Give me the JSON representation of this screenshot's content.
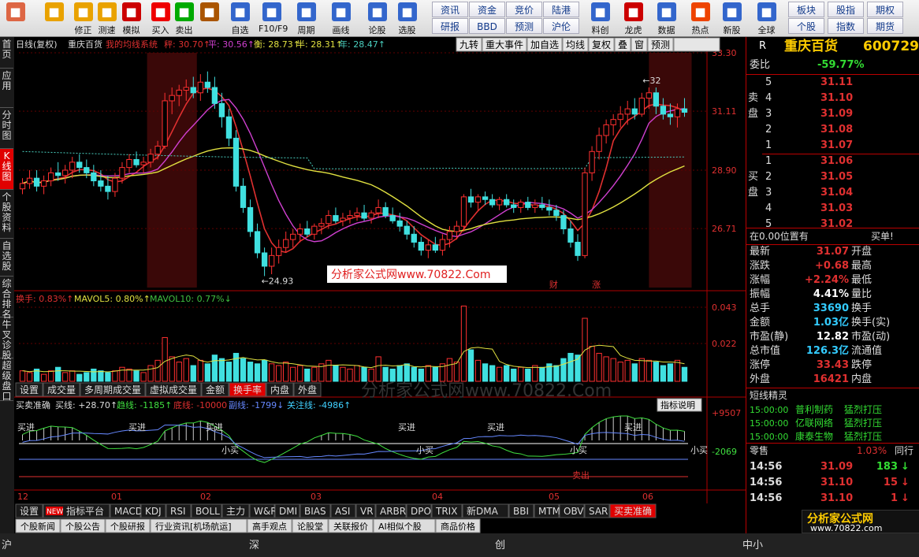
{
  "toolbar": {
    "buttons": [
      {
        "label": "",
        "icon": "home-grid-icon",
        "color": "#d64"
      },
      {
        "label": "",
        "icon": "back-arrow-icon",
        "color": "#e9a200"
      },
      {
        "label": "修正",
        "icon": "arrow-updown-icon",
        "color": "#e9a200"
      },
      {
        "label": "测速",
        "icon": "speed-clock-icon",
        "color": "#e9a200"
      },
      {
        "label": "模拟",
        "icon": "clock-icon",
        "color": "#c00"
      },
      {
        "label": "买入",
        "icon": "buy-icon",
        "color": "#e00"
      },
      {
        "label": "卖出",
        "icon": "sell-icon",
        "color": "#0a0"
      },
      {
        "label": "",
        "icon": "hammer-icon",
        "color": "#a50"
      },
      {
        "label": "自选",
        "icon": "folder-icon",
        "color": "#36c"
      },
      {
        "label": "F10/F9",
        "icon": "f10-icon",
        "color": "#36c"
      },
      {
        "label": "周期",
        "icon": "cycle-clock-icon",
        "color": "#36c"
      },
      {
        "label": "画线",
        "icon": "pencil-icon",
        "color": "#36c"
      },
      {
        "label": "论股",
        "icon": "discuss-icon",
        "color": "#36c"
      },
      {
        "label": "选股",
        "icon": "chart-search-icon",
        "color": "#36c"
      }
    ],
    "small": [
      "资讯",
      "资金",
      "竞价",
      "陆港",
      "研报",
      "BBD",
      "预测",
      "沪伦"
    ],
    "buttons2": [
      {
        "label": "料创",
        "icon": "trend-icon",
        "color": "#36c"
      },
      {
        "label": "龙虎",
        "icon": "dragon-icon",
        "color": "#c00"
      },
      {
        "label": "数据",
        "icon": "pe-icon",
        "color": "#36c"
      },
      {
        "label": "热点",
        "icon": "hot-icon",
        "color": "#e40"
      },
      {
        "label": "新股",
        "icon": "new-stock-icon",
        "color": "#36c"
      },
      {
        "label": "全球",
        "icon": "globe-icon",
        "color": "#36c"
      }
    ],
    "small2": [
      "板块",
      "股指",
      "期权",
      "个股",
      "指数",
      "期货"
    ]
  },
  "left_tabs": [
    "首页",
    "应用",
    "分时图",
    "K线图",
    "个股资料",
    "自选股",
    "综合排名",
    "牛叉诊股",
    "超级盘口"
  ],
  "header": {
    "prefix": "日线(复权)",
    "name": "重庆百货",
    "system": "我的均线系统",
    "ma1": "秤: 30.70↑",
    "ma2": "平: 30.56↑",
    "ma3": "衡: 28.73↑",
    "ma4": "半: 28.31↑",
    "ma5": "年: 28.47↑"
  },
  "chart_buttons": [
    "九转",
    "重大事件",
    "加自选",
    "均线",
    "复权",
    "叠",
    "窗",
    "预测"
  ],
  "price_axis": [
    "33.30",
    "31.11",
    "28.90",
    "26.71"
  ],
  "vol_axis": [
    "0.043",
    "0.022"
  ],
  "ind_axis": [
    "+9507",
    "-2069"
  ],
  "x_axis": [
    "12",
    "01",
    "02",
    "03",
    "04",
    "05",
    "06"
  ],
  "annotations": {
    "high": "32",
    "low": "24.93",
    "watermark": "分析家公式网www.70822.Com",
    "wm_bg": "分析家公式网www.70822.Com",
    "cai": "财",
    "zhang": "涨"
  },
  "chart_data": {
    "type": "candlestick",
    "candles": [
      [
        28.2,
        28.6,
        28.0,
        28.4
      ],
      [
        28.4,
        28.9,
        28.2,
        28.6
      ],
      [
        28.6,
        28.9,
        28.1,
        28.3
      ],
      [
        28.3,
        28.7,
        28.0,
        28.5
      ],
      [
        28.5,
        29.0,
        28.3,
        28.8
      ],
      [
        28.8,
        29.2,
        28.5,
        28.7
      ],
      [
        28.7,
        29.1,
        28.4,
        28.9
      ],
      [
        28.9,
        29.4,
        28.6,
        29.2
      ],
      [
        29.2,
        29.5,
        28.8,
        29.0
      ],
      [
        29.0,
        29.3,
        28.6,
        28.8
      ],
      [
        28.8,
        29.1,
        28.3,
        28.5
      ],
      [
        28.5,
        28.9,
        28.1,
        28.3
      ],
      [
        28.3,
        28.7,
        27.8,
        28.1
      ],
      [
        28.1,
        28.8,
        27.9,
        28.6
      ],
      [
        28.6,
        29.2,
        28.4,
        29.0
      ],
      [
        29.0,
        29.5,
        28.8,
        29.3
      ],
      [
        29.3,
        29.6,
        29.0,
        29.1
      ],
      [
        29.1,
        29.4,
        28.8,
        29.2
      ],
      [
        29.2,
        29.7,
        29.0,
        29.5
      ],
      [
        29.5,
        30.0,
        29.3,
        29.8
      ],
      [
        29.8,
        31.8,
        29.7,
        31.5
      ],
      [
        31.5,
        32.0,
        31.0,
        31.7
      ],
      [
        31.7,
        32.1,
        31.3,
        31.9
      ],
      [
        31.9,
        32.3,
        31.5,
        32.0
      ],
      [
        32.0,
        32.4,
        31.6,
        31.8
      ],
      [
        31.8,
        32.5,
        31.5,
        32.2
      ],
      [
        32.2,
        32.6,
        31.8,
        32.0
      ],
      [
        32.0,
        32.4,
        31.2,
        31.4
      ],
      [
        31.4,
        31.8,
        30.5,
        30.9
      ],
      [
        30.9,
        31.2,
        29.8,
        30.1
      ],
      [
        30.1,
        30.4,
        28.1,
        28.3
      ],
      [
        28.3,
        28.6,
        27.3,
        27.5
      ],
      [
        27.5,
        27.8,
        26.4,
        26.6
      ],
      [
        26.6,
        26.9,
        25.6,
        25.8
      ],
      [
        25.8,
        26.0,
        24.93,
        25.3
      ],
      [
        25.3,
        26.0,
        25.0,
        25.7
      ],
      [
        25.7,
        26.3,
        25.4,
        26.0
      ],
      [
        26.0,
        26.6,
        25.8,
        26.3
      ],
      [
        26.3,
        26.7,
        26.0,
        26.5
      ],
      [
        26.5,
        26.9,
        26.2,
        26.7
      ],
      [
        26.7,
        27.0,
        26.4,
        26.5
      ],
      [
        26.5,
        26.9,
        26.3,
        26.8
      ],
      [
        26.8,
        27.1,
        26.5,
        26.9
      ],
      [
        26.9,
        27.4,
        26.7,
        27.2
      ],
      [
        27.2,
        27.5,
        26.9,
        27.0
      ],
      [
        27.0,
        27.3,
        26.8,
        27.1
      ],
      [
        27.1,
        27.4,
        26.9,
        27.2
      ],
      [
        27.2,
        27.5,
        27.0,
        27.3
      ],
      [
        27.3,
        27.6,
        27.0,
        27.1
      ],
      [
        27.1,
        27.4,
        26.9,
        27.3
      ],
      [
        27.3,
        27.8,
        27.1,
        27.5
      ],
      [
        27.5,
        27.7,
        27.1,
        27.2
      ],
      [
        27.2,
        27.5,
        26.9,
        27.0
      ],
      [
        27.0,
        27.3,
        26.6,
        26.8
      ],
      [
        26.8,
        27.0,
        26.3,
        26.5
      ],
      [
        26.5,
        26.8,
        26.0,
        26.2
      ],
      [
        26.2,
        26.4,
        25.7,
        25.9
      ],
      [
        25.9,
        26.3,
        25.6,
        26.1
      ],
      [
        26.1,
        26.4,
        25.8,
        25.9
      ],
      [
        25.9,
        26.5,
        25.7,
        26.3
      ],
      [
        26.3,
        26.8,
        26.0,
        26.6
      ],
      [
        26.6,
        27.0,
        26.3,
        26.8
      ],
      [
        26.8,
        28.0,
        26.6,
        27.9
      ],
      [
        27.9,
        28.2,
        27.5,
        27.7
      ],
      [
        27.7,
        28.0,
        27.4,
        27.9
      ],
      [
        27.9,
        28.1,
        27.6,
        27.8
      ],
      [
        27.8,
        28.0,
        27.5,
        27.6
      ],
      [
        27.6,
        27.9,
        27.4,
        27.8
      ],
      [
        27.8,
        28.0,
        27.5,
        27.6
      ],
      [
        27.6,
        27.8,
        27.3,
        27.5
      ],
      [
        27.5,
        27.8,
        27.3,
        27.7
      ],
      [
        27.7,
        27.9,
        27.4,
        27.5
      ],
      [
        27.5,
        27.8,
        27.3,
        27.6
      ],
      [
        27.6,
        27.9,
        27.4,
        27.5
      ],
      [
        27.5,
        27.8,
        27.2,
        27.4
      ],
      [
        27.4,
        27.6,
        27.0,
        27.2
      ],
      [
        27.2,
        27.4,
        26.5,
        26.7
      ],
      [
        26.7,
        27.0,
        26.0,
        26.2
      ],
      [
        26.2,
        26.5,
        25.5,
        25.7
      ],
      [
        25.7,
        29.0,
        25.6,
        28.8
      ],
      [
        28.8,
        29.8,
        28.5,
        29.6
      ],
      [
        29.6,
        30.5,
        29.3,
        30.2
      ],
      [
        30.2,
        30.8,
        29.9,
        30.6
      ],
      [
        30.6,
        31.0,
        30.2,
        30.8
      ],
      [
        30.8,
        31.3,
        30.5,
        31.0
      ],
      [
        31.0,
        31.5,
        30.6,
        31.2
      ],
      [
        31.2,
        31.6,
        30.8,
        31.0
      ],
      [
        31.0,
        31.8,
        30.9,
        31.6
      ],
      [
        31.6,
        32.0,
        31.2,
        31.8
      ],
      [
        31.8,
        32.0,
        31.0,
        31.3
      ],
      [
        31.3,
        31.6,
        30.8,
        31.0
      ],
      [
        31.0,
        31.4,
        30.6,
        30.9
      ],
      [
        30.9,
        31.4,
        30.5,
        31.2
      ],
      [
        31.2,
        31.6,
        30.9,
        31.07
      ]
    ],
    "ma_series": [
      {
        "name": "秤",
        "color": "#e03030"
      },
      {
        "name": "平",
        "color": "#d040d0"
      },
      {
        "name": "半",
        "color": "#e0e040"
      },
      {
        "name": "年",
        "color": "#4ad0c0"
      }
    ],
    "ylim": [
      24.5,
      33.3
    ],
    "volume_pct": [
      0.6,
      0.5,
      0.7,
      0.4,
      0.6,
      0.8,
      0.5,
      0.6,
      0.4,
      0.5,
      0.7,
      0.6,
      0.5,
      0.6,
      0.8,
      0.7,
      0.6,
      0.5,
      0.9,
      1.2,
      2.5,
      1.4,
      1.1,
      1.3,
      0.9,
      1.2,
      1.0,
      1.5,
      1.3,
      1.1,
      1.6,
      1.3,
      1.1,
      1.0,
      1.2,
      1.0,
      0.9,
      1.1,
      0.8,
      0.9,
      0.7,
      0.8,
      1.0,
      1.2,
      0.9,
      0.8,
      0.7,
      0.9,
      0.8,
      0.7,
      1.4,
      0.8,
      0.7,
      0.9,
      1.0,
      0.8,
      0.7,
      0.9,
      0.8,
      1.0,
      1.3,
      1.1,
      4.3,
      1.8,
      1.2,
      1.0,
      0.9,
      0.8,
      0.9,
      0.7,
      0.8,
      0.7,
      0.9,
      0.8,
      1.0,
      0.9,
      1.3,
      1.6,
      1.5,
      3.6,
      2.0,
      1.6,
      1.4,
      1.3,
      1.1,
      1.2,
      1.0,
      1.3,
      1.2,
      1.1,
      0.9,
      1.0,
      1.2,
      0.8
    ]
  },
  "vol_header": {
    "a": "换手: 0.83%↑",
    "b": "MAVOL5: 0.80%↑",
    "c": "MAVOL10: 0.77%↓"
  },
  "vol_tabs": [
    "设置",
    "成交量",
    "多周期成交量",
    "虚拟成交量",
    "金额",
    "换手率",
    "内盘",
    "外盘"
  ],
  "ind_header": {
    "name": "买卖准确",
    "a": "买线: +28.70↑",
    "b": "趋线: -1185↑",
    "c": "底线: -10000",
    "d": "副线: -1799↓",
    "e": "关注线: -4986↑",
    "btn": "指标说明"
  },
  "ind_labels": {
    "buy": "买进",
    "small": "小买",
    "sell": "卖出"
  },
  "ind_tabs": [
    "设置",
    "指标平台",
    "MACD",
    "KDJ",
    "RSI",
    "BOLL",
    "主力",
    "W&R",
    "DMI",
    "BIAS",
    "ASI",
    "VR",
    "ARBR",
    "DPO",
    "TRIX",
    "新DMA",
    "BBI",
    "MTM",
    "OBV",
    "SAR",
    "买卖准确"
  ],
  "new_badge": "NEW",
  "news_tabs": [
    "个股新闻",
    "个股公告",
    "个股研报",
    "行业资讯[机场航运]",
    "高手观点",
    "论股堂",
    "关联报价",
    "AI相似个股",
    "商品价格"
  ],
  "right": {
    "title": "重庆百货",
    "code": "600729",
    "r": "R",
    "wb_label": "委比",
    "wb_val": "-59.77%",
    "sell_label": "卖盘",
    "buy_label": "买盘",
    "sell": [
      {
        "n": "5",
        "p": "31.11"
      },
      {
        "n": "4",
        "p": "31.10"
      },
      {
        "n": "3",
        "p": "31.09"
      },
      {
        "n": "2",
        "p": "31.08"
      },
      {
        "n": "1",
        "p": "31.07"
      }
    ],
    "buy": [
      {
        "n": "1",
        "p": "31.06"
      },
      {
        "n": "2",
        "p": "31.05"
      },
      {
        "n": "3",
        "p": "31.04"
      },
      {
        "n": "4",
        "p": "31.03"
      },
      {
        "n": "5",
        "p": "31.02"
      }
    ],
    "pos": "在0.00位置有",
    "pos_r": "买单!",
    "quote": [
      {
        "k": "最新",
        "v": "31.07",
        "k2": "开盘",
        "c": "#e03030"
      },
      {
        "k": "涨跌",
        "v": "+0.68",
        "k2": "最高",
        "c": "#e03030"
      },
      {
        "k": "涨幅",
        "v": "+2.24%",
        "k2": "最低",
        "c": "#e03030"
      },
      {
        "k": "振幅",
        "v": "4.41%",
        "k2": "量比",
        "c": "#ffffff"
      },
      {
        "k": "总手",
        "v": "33690",
        "k2": "换手",
        "c": "#33ccff"
      },
      {
        "k": "金额",
        "v": "1.03亿",
        "k2": "换手(实)",
        "c": "#33ccff"
      },
      {
        "k": "市盈(静)",
        "v": "12.82",
        "k2": "市盈(动)",
        "c": "#ffffff"
      },
      {
        "k": "总市值",
        "v": "126.3亿",
        "k2": "流通值",
        "c": "#33ccff"
      },
      {
        "k": "涨停",
        "v": "33.43",
        "k2": "跌停",
        "c": "#e03030"
      },
      {
        "k": "外盘",
        "v": "16421",
        "k2": "内盘",
        "c": "#e03030"
      }
    ],
    "jl_title": "短线精灵",
    "jl": [
      {
        "t": "15:00:00",
        "n": "普利制药",
        "s": "猛烈打压"
      },
      {
        "t": "15:00:00",
        "n": "亿联网络",
        "s": "猛烈打压"
      },
      {
        "t": "15:00:00",
        "n": "康泰生物",
        "s": "猛烈打压"
      }
    ],
    "ls_title": "零售",
    "ls_pct": "1.03%",
    "ls_tab": "同行",
    "trades": [
      {
        "t": "14:56",
        "p": "31.09",
        "v": "183",
        "d": "↓",
        "c": "#33dd33"
      },
      {
        "t": "14:56",
        "p": "31.10",
        "v": "15",
        "d": "↓",
        "c": "#e03030"
      },
      {
        "t": "14:56",
        "p": "31.10",
        "v": "1",
        "d": "↓",
        "c": "#e03030"
      }
    ],
    "site": "分析家公式网",
    "site_url": "www.70822.com"
  },
  "status": [
    "沪",
    "深",
    "创",
    "中小"
  ]
}
